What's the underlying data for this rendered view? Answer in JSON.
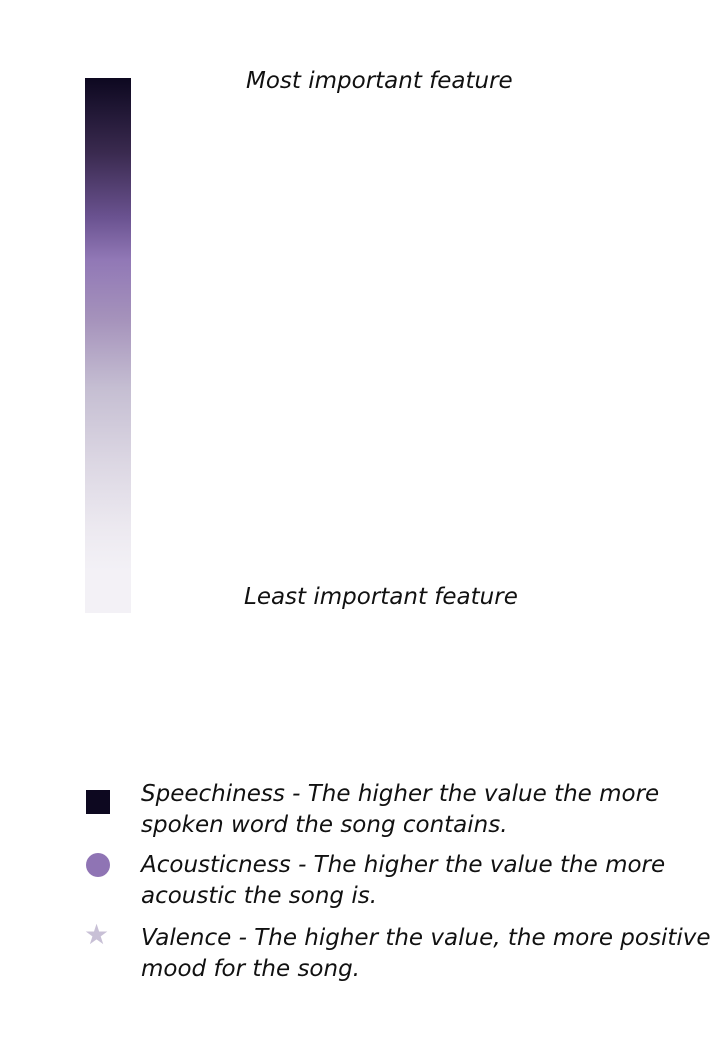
{
  "scale": {
    "top_label": "Most important feature",
    "bottom_label": "Least important feature",
    "colors": {
      "top": "#0d0820",
      "mid": "#8f74b4",
      "bottom": "#f3f1f6"
    }
  },
  "legend": [
    {
      "icon": "square-icon",
      "color": "#0d0820",
      "text": "Speechiness - The higher the value the more spoken word the song contains."
    },
    {
      "icon": "circle-icon",
      "color": "#8f74b4",
      "text": "Acousticness - The higher the value the more acoustic the song is."
    },
    {
      "icon": "star-icon",
      "color": "#c8c0d6",
      "text": "Valence - The higher the value, the more positive mood for the song."
    }
  ]
}
